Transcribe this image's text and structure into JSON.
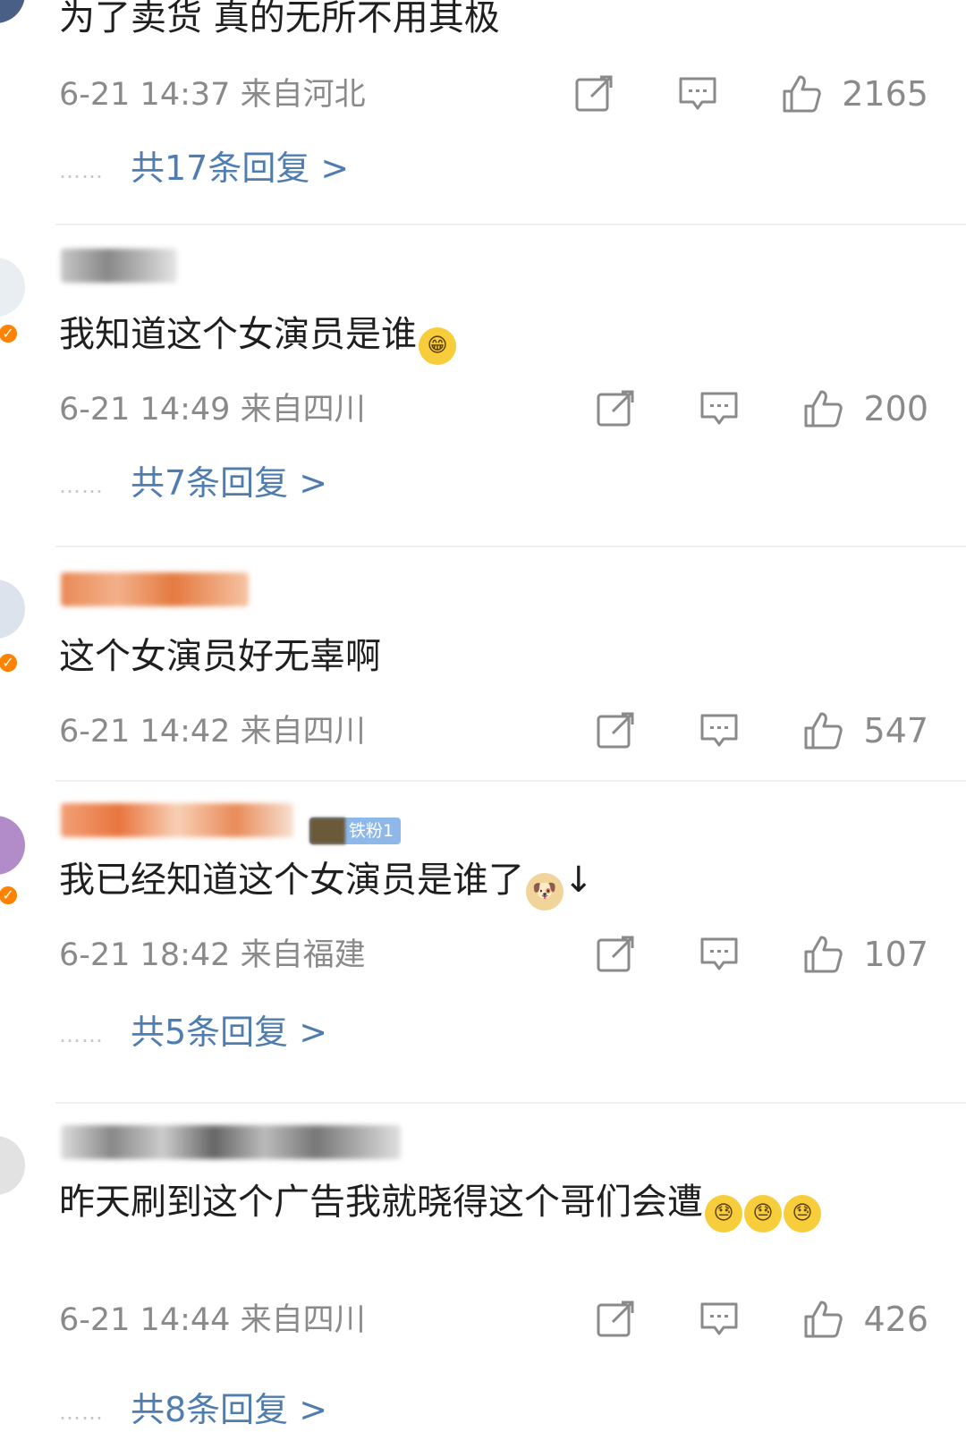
{
  "comments": [
    {
      "text": "为了卖货 真的无所不用其极",
      "date": "6-21 14:37",
      "location": "来自河北",
      "likes": "2165",
      "replies": "共17条回复 >"
    },
    {
      "text": "我知道这个女演员是谁",
      "emoji": "grin-emoji",
      "date": "6-21 14:49",
      "location": "来自四川",
      "likes": "200",
      "replies": "共7条回复 >"
    },
    {
      "text": "这个女演员好无辜啊",
      "date": "6-21 14:42",
      "location": "来自四川",
      "likes": "547"
    },
    {
      "text": "我已经知道这个女演员是谁了",
      "emoji": "doge-emoji",
      "suffix": "↓",
      "fan_badge": "铁粉1",
      "date": "6-21 18:42",
      "location": "来自福建",
      "likes": "107",
      "replies": "共5条回复 >"
    },
    {
      "text": "昨天刷到这个广告我就晓得这个哥们会遭",
      "emoji": "sweat-emoji",
      "date": "6-21 14:44",
      "location": "来自四川",
      "likes": "426",
      "replies": "共8条回复 >"
    }
  ],
  "reply_dots": "……",
  "colors": {
    "link": "#507daf",
    "meta": "#8a8a8a",
    "verified": "#ff8200"
  }
}
